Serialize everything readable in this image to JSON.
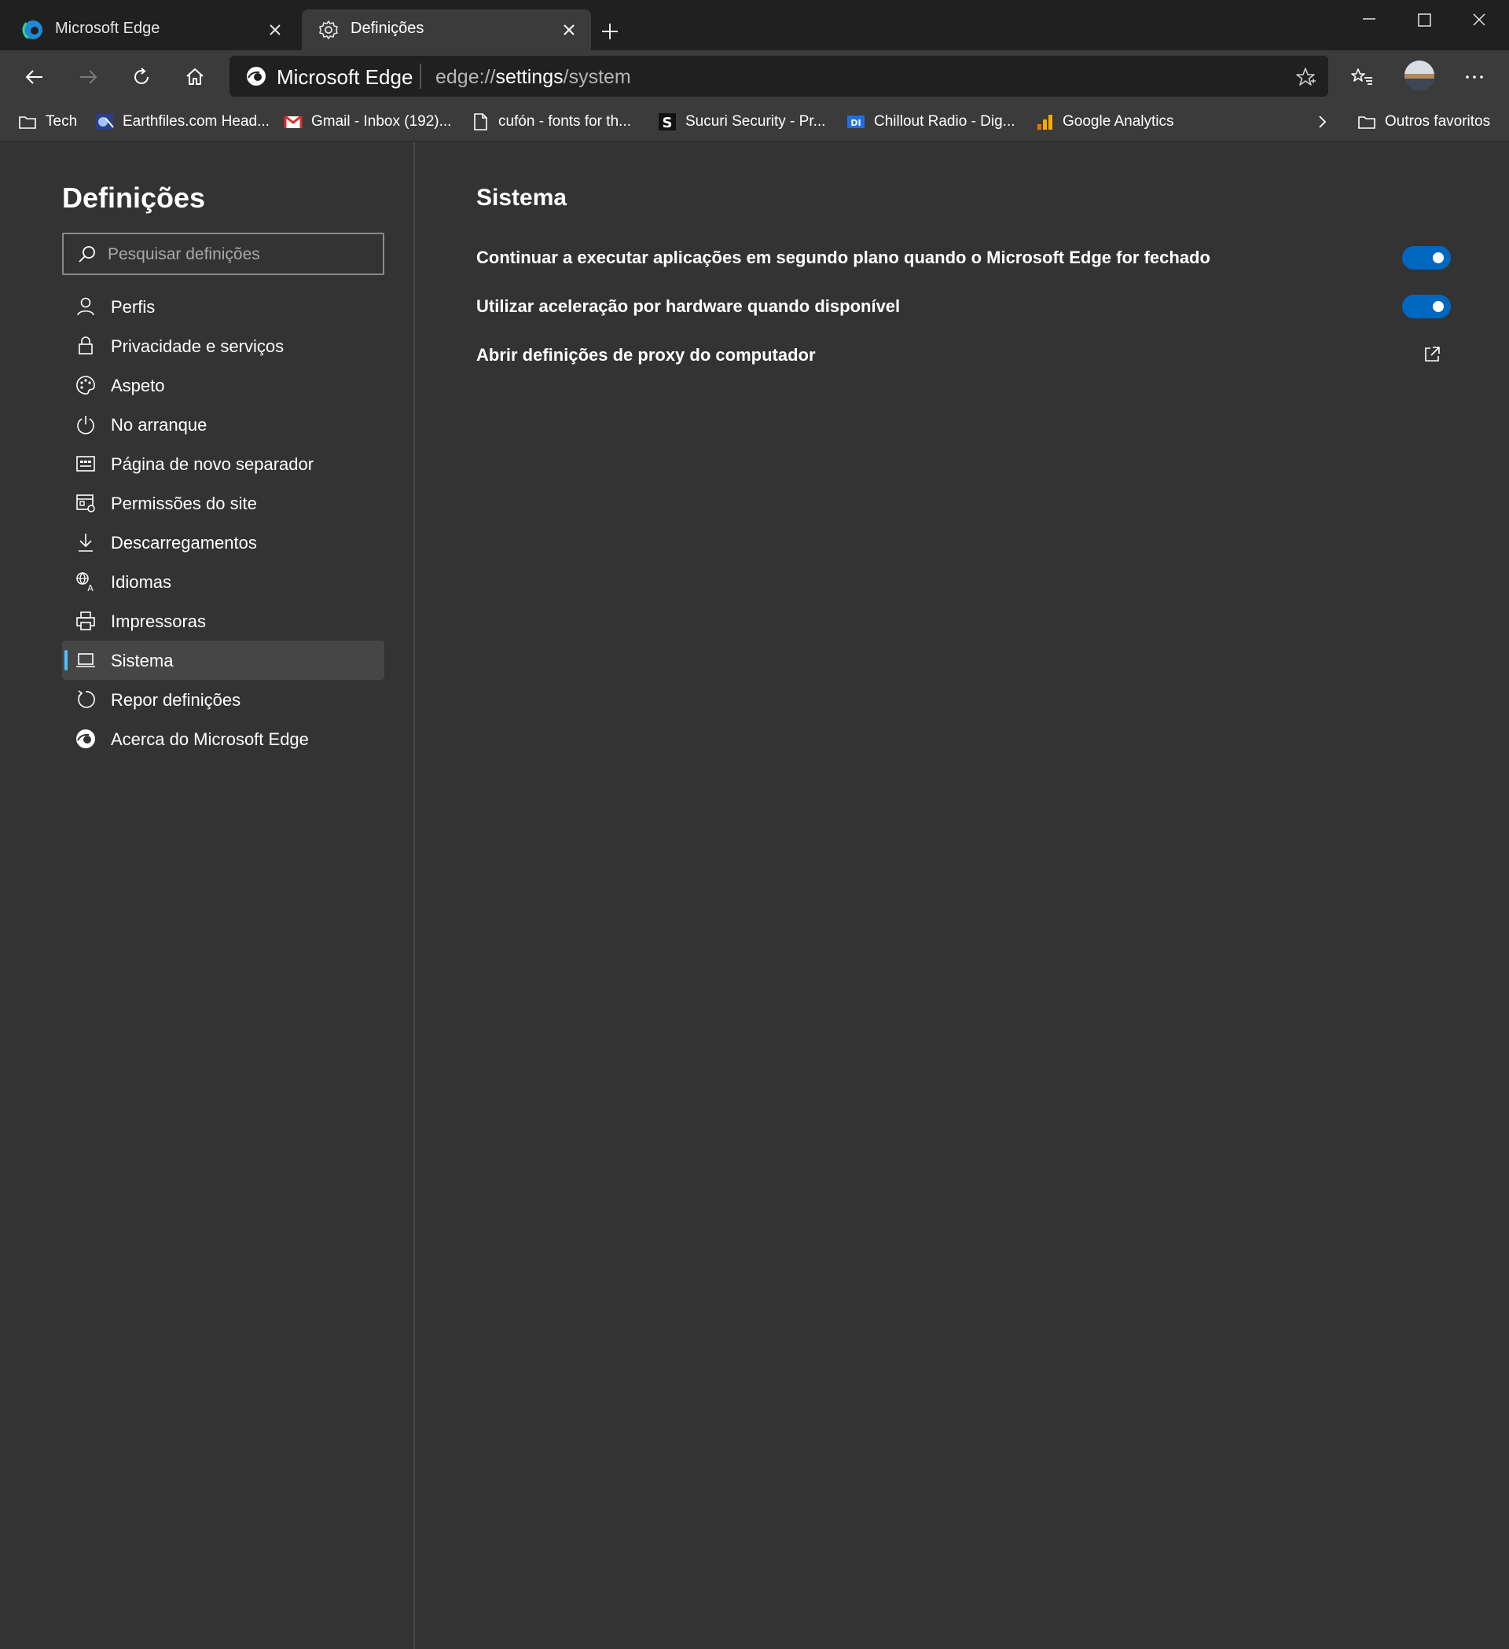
{
  "browser": {
    "tabs": [
      {
        "label": "Microsoft Edge",
        "icon": "edge-logo-icon",
        "active": false
      },
      {
        "label": "Definições",
        "icon": "gear-icon",
        "active": true
      }
    ],
    "address": {
      "site_name": "Microsoft Edge",
      "url_prefix": "edge://",
      "url_strong": "settings",
      "url_suffix": "/system"
    },
    "favorites": [
      {
        "label": "Tech",
        "icon": "folder-icon"
      },
      {
        "label": "Earthfiles.com Head...",
        "icon": "earthfiles-icon"
      },
      {
        "label": "Gmail - Inbox (192)...",
        "icon": "gmail-icon"
      },
      {
        "label": "cufón - fonts for th...",
        "icon": "page-icon"
      },
      {
        "label": "Sucuri Security - Pr...",
        "icon": "sucuri-icon"
      },
      {
        "label": "Chillout Radio - Dig...",
        "icon": "di-radio-icon"
      },
      {
        "label": "Google Analytics",
        "icon": "analytics-icon"
      }
    ],
    "other_favorites": "Outros favoritos"
  },
  "sidebar": {
    "title": "Definições",
    "search_placeholder": "Pesquisar definições",
    "items": [
      {
        "label": "Perfis",
        "icon": "person-icon"
      },
      {
        "label": "Privacidade e serviços",
        "icon": "lock-icon"
      },
      {
        "label": "Aspeto",
        "icon": "palette-icon"
      },
      {
        "label": "No arranque",
        "icon": "power-icon"
      },
      {
        "label": "Página de novo separador",
        "icon": "new-tab-page-icon"
      },
      {
        "label": "Permissões do site",
        "icon": "site-permissions-icon"
      },
      {
        "label": "Descarregamentos",
        "icon": "download-icon"
      },
      {
        "label": "Idiomas",
        "icon": "language-icon"
      },
      {
        "label": "Impressoras",
        "icon": "printer-icon"
      },
      {
        "label": "Sistema",
        "icon": "laptop-icon",
        "selected": true
      },
      {
        "label": "Repor definições",
        "icon": "reset-icon"
      },
      {
        "label": "Acerca do Microsoft Edge",
        "icon": "edge-logo-icon"
      }
    ]
  },
  "main": {
    "title": "Sistema",
    "settings": [
      {
        "label": "Continuar a executar aplicações em segundo plano quando o Microsoft Edge for fechado",
        "type": "toggle",
        "on": true
      },
      {
        "label": "Utilizar aceleração por hardware quando disponível",
        "type": "toggle",
        "on": true
      },
      {
        "label": "Abrir definições de proxy do computador",
        "type": "external-link"
      }
    ]
  },
  "colors": {
    "accent": "#0067c0",
    "selection_indicator": "#4cc2ff",
    "content_background": "#333333",
    "chrome_background": "#202020"
  }
}
